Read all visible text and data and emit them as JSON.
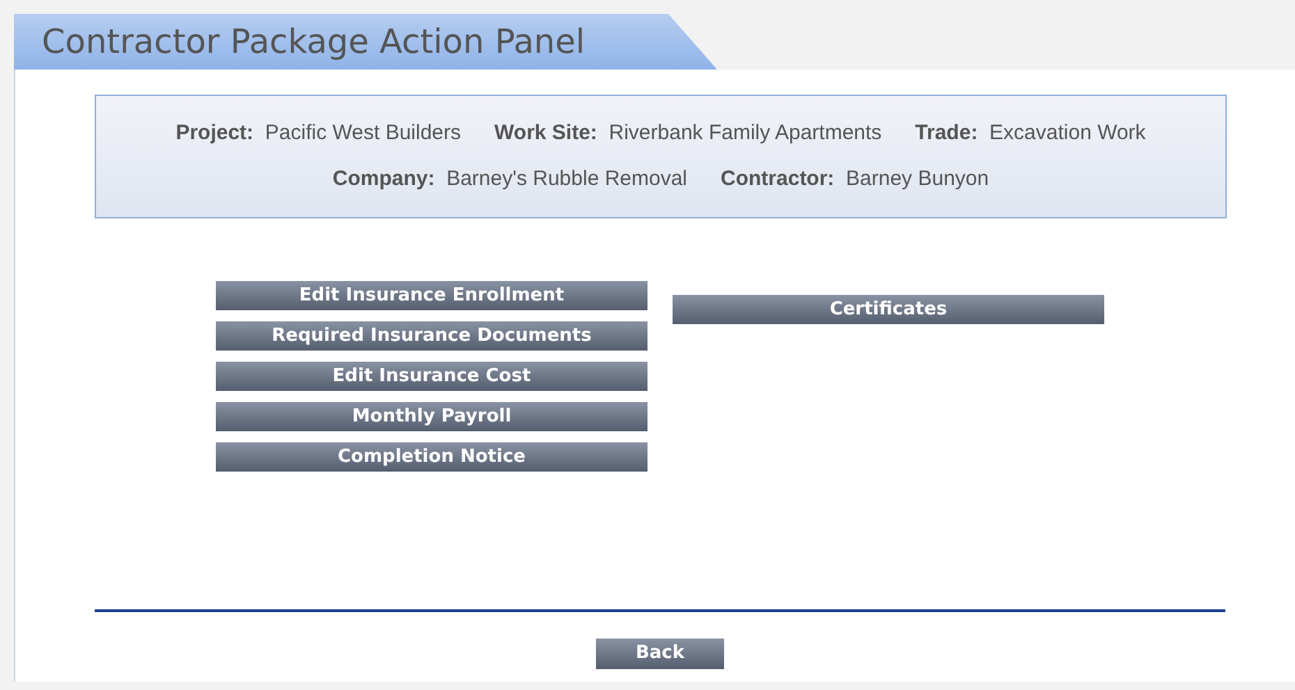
{
  "panel": {
    "title": "Contractor Package Action Panel"
  },
  "info_lines": [
    [
      {
        "label": "Project:",
        "value": "Pacific West Builders"
      },
      {
        "label": "Work Site:",
        "value": "Riverbank Family Apartments"
      },
      {
        "label": "Trade:",
        "value": "Excavation Work"
      }
    ],
    [
      {
        "label": "Company:",
        "value": "Barney's Rubble Removal"
      },
      {
        "label": "Contractor:",
        "value": "Barney Bunyon"
      }
    ]
  ],
  "left_actions": [
    "Edit Insurance Enrollment",
    "Required Insurance Documents",
    "Edit Insurance Cost",
    "Monthly Payroll",
    "Completion Notice"
  ],
  "right_actions": [
    "Certificates"
  ],
  "back_button": "Back"
}
